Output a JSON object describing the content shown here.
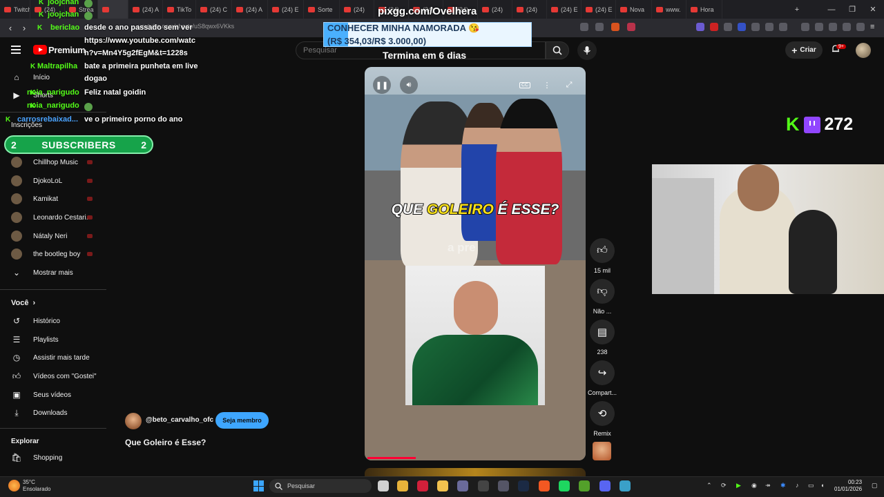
{
  "browser": {
    "tabs": [
      {
        "label": "Twitch",
        "active": false
      },
      {
        "label": "(24)",
        "active": false
      },
      {
        "label": "Strea",
        "active": false
      },
      {
        "label": "",
        "active": true
      },
      {
        "label": "(24) A",
        "active": false
      },
      {
        "label": "TikTo",
        "active": false
      },
      {
        "label": "(24) C",
        "active": false
      },
      {
        "label": "(24) A",
        "active": false
      },
      {
        "label": "(24) E",
        "active": false
      },
      {
        "label": "Sorte",
        "active": false
      },
      {
        "label": "(24)",
        "active": false
      },
      {
        "label": "(24)",
        "active": false
      },
      {
        "label": "(24)",
        "active": false
      },
      {
        "label": "(24)",
        "active": false
      },
      {
        "label": "(24)",
        "active": false
      },
      {
        "label": "(24)",
        "active": false
      },
      {
        "label": "(24) E",
        "active": false
      },
      {
        "label": "(24) E",
        "active": false
      },
      {
        "label": "Nova",
        "active": false
      },
      {
        "label": "www.",
        "active": false
      },
      {
        "label": "Hora",
        "active": false
      }
    ],
    "url": "youtube.com/shorts/uS8qwx6VKks",
    "new_tab": "+",
    "controls": {
      "minimize": "—",
      "maximize": "❐",
      "close": "✕"
    }
  },
  "youtube": {
    "brand": "Premium",
    "search_placeholder": "Pesquisar",
    "create_label": "Criar",
    "notifications_badge": "9+"
  },
  "sidebar": {
    "top_items": [
      {
        "label": "Início",
        "icon": "home-icon"
      },
      {
        "label": "Shorts",
        "icon": "shorts-icon"
      }
    ],
    "subs_header": "Inscrições",
    "subscriptions": [
      {
        "label": "Chillhop Music"
      },
      {
        "label": "DjokoLoL"
      },
      {
        "label": "Kamikat"
      },
      {
        "label": "Leonardo Cestari..."
      },
      {
        "label": "Nátaly Neri"
      },
      {
        "label": "the bootleg boy"
      }
    ],
    "show_more": "Mostrar mais",
    "you_header": "Você",
    "you_items": [
      {
        "label": "Histórico",
        "icon": "history-icon"
      },
      {
        "label": "Playlists",
        "icon": "playlists-icon"
      },
      {
        "label": "Assistir mais tarde",
        "icon": "watch-later-icon"
      },
      {
        "label": "Vídeos com \"Gostei\"",
        "icon": "like-icon"
      },
      {
        "label": "Seus vídeos",
        "icon": "your-videos-icon"
      },
      {
        "label": "Downloads",
        "icon": "download-icon"
      }
    ],
    "explore_header": "Explorar",
    "explore_items": [
      {
        "label": "Shopping",
        "icon": "shopping-icon"
      }
    ]
  },
  "chat": [
    {
      "user": "joojchan",
      "message": ""
    },
    {
      "user": "joojchan",
      "message": ""
    },
    {
      "user": "bericlao",
      "message": "desde o ano passado sem ver"
    },
    {
      "user": "",
      "message": "https://www.youtube.com/watc"
    },
    {
      "user": "",
      "message": "h?v=Mn4Y5g2fEgM&t=1228s"
    },
    {
      "user": "Maltrapilha",
      "message": "bate a primeira punheta em live"
    },
    {
      "user": "",
      "message": "dogao"
    },
    {
      "user": "noia_narigudo",
      "message": "Feliz natal goidin"
    },
    {
      "user": "noia_narigudo",
      "message": ""
    },
    {
      "user": "carrosrebaixad...",
      "message": "ve o primeiro porno do ano"
    }
  ],
  "subs_bar": {
    "left": "2",
    "label": "SUBSCRIBERS",
    "right": "2"
  },
  "stream_overlay": {
    "url": "pixgg.com/Ovelhera",
    "goal_title": "CONHECER MINHA NAMORADA",
    "goal_amount": "(R$ 354,03/R$ 3.000,00)",
    "goal_progress": 0.118,
    "goal_ends": "Termina em 6 dias",
    "viewer_count": "272"
  },
  "video": {
    "caption_a": "QUE ",
    "caption_b": "GOLEIRO",
    "caption_c": " É ESSE?",
    "ghost_text": "a pre",
    "progress": 0.22
  },
  "actions": [
    {
      "label": "15 mil",
      "icon": "like-icon"
    },
    {
      "label": "Não ...",
      "icon": "dislike-icon"
    },
    {
      "label": "238",
      "icon": "comment-icon"
    },
    {
      "label": "Compart...",
      "icon": "share-icon"
    },
    {
      "label": "Remix",
      "icon": "remix-icon"
    }
  ],
  "channel": {
    "name": "@beto_carvalho_ofc",
    "join_label": "Seja membro",
    "title": "Que Goleiro é Esse?"
  },
  "taskbar": {
    "temperature": "35°C",
    "weather": "Ensolarado",
    "search": "Pesquisar",
    "time": "00:23",
    "date": "01/01/2026"
  },
  "colors": {
    "kick_green": "#53fc18",
    "yt_red": "#ff0000",
    "accent_blue": "#3ea6ff"
  }
}
